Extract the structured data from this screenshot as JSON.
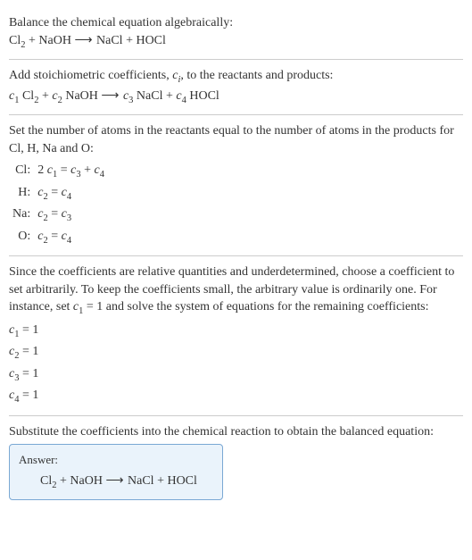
{
  "section1": {
    "title": "Balance the chemical equation algebraically:",
    "eq_pre_arrow": "Cl",
    "eq_sub1": "2",
    "eq_mid": " + NaOH ",
    "arrow": "⟶",
    "eq_post": " NaCl + HOCl"
  },
  "section2": {
    "intro_a": "Add stoichiometric coefficients, ",
    "intro_ci": "c",
    "intro_sub_i": "i",
    "intro_b": ", to the reactants and products:",
    "c1": "c",
    "s1": "1",
    "sp1": " Cl",
    "sub2": "2",
    "plus1": " + ",
    "c2": "c",
    "s2": "2",
    "sp2": " NaOH ",
    "arrow": "⟶",
    "sp3": " ",
    "c3": "c",
    "s3": "3",
    "sp4": " NaCl + ",
    "c4": "c",
    "s4": "4",
    "sp5": " HOCl"
  },
  "section3": {
    "intro": "Set the number of atoms in the reactants equal to the number of atoms in the products for Cl, H, Na and O:",
    "rows": [
      {
        "el": "Cl:",
        "lhs_pre": "2 ",
        "lhs_c": "c",
        "lhs_s": "1",
        "eq": " = ",
        "r1c": "c",
        "r1s": "3",
        "plus": " + ",
        "r2c": "c",
        "r2s": "4"
      },
      {
        "el": "H:",
        "lhs_pre": "",
        "lhs_c": "c",
        "lhs_s": "2",
        "eq": " = ",
        "r1c": "c",
        "r1s": "4",
        "plus": "",
        "r2c": "",
        "r2s": ""
      },
      {
        "el": "Na:",
        "lhs_pre": "",
        "lhs_c": "c",
        "lhs_s": "2",
        "eq": " = ",
        "r1c": "c",
        "r1s": "3",
        "plus": "",
        "r2c": "",
        "r2s": ""
      },
      {
        "el": "O:",
        "lhs_pre": "",
        "lhs_c": "c",
        "lhs_s": "2",
        "eq": " = ",
        "r1c": "c",
        "r1s": "4",
        "plus": "",
        "r2c": "",
        "r2s": ""
      }
    ]
  },
  "section4": {
    "intro_a": "Since the coefficients are relative quantities and underdetermined, choose a coefficient to set arbitrarily. To keep the coefficients small, the arbitrary value is ordinarily one. For instance, set ",
    "c1": "c",
    "s1": "1",
    "intro_b": " = 1 and solve the system of equations for the remaining coefficients:",
    "coeffs": [
      {
        "c": "c",
        "s": "1",
        "v": " = 1"
      },
      {
        "c": "c",
        "s": "2",
        "v": " = 1"
      },
      {
        "c": "c",
        "s": "3",
        "v": " = 1"
      },
      {
        "c": "c",
        "s": "4",
        "v": " = 1"
      }
    ]
  },
  "section5": {
    "intro": "Substitute the coefficients into the chemical reaction to obtain the balanced equation:",
    "answer_label": "Answer:",
    "eq_pre": "Cl",
    "eq_sub": "2",
    "eq_mid": " + NaOH ",
    "arrow": "⟶",
    "eq_post": " NaCl + HOCl"
  }
}
